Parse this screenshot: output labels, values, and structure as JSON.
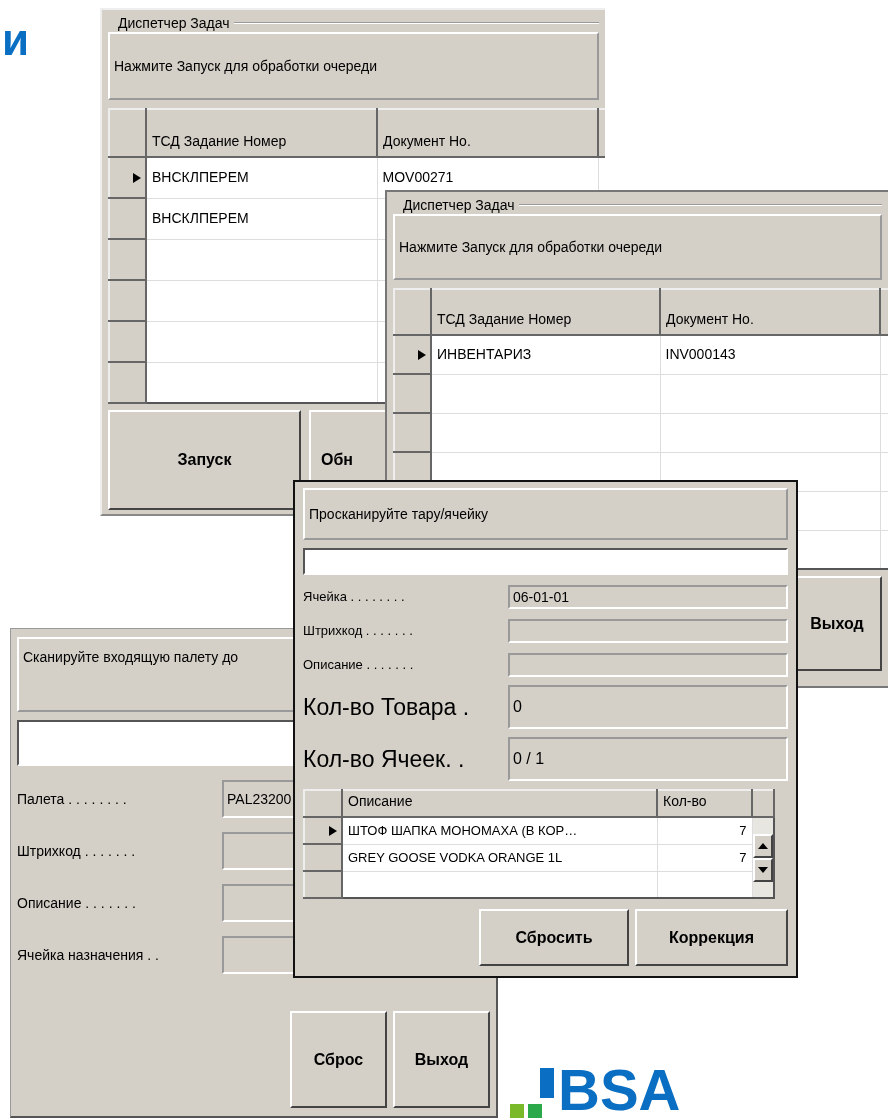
{
  "heading": "и",
  "windows": [
    {
      "kind": "task_dispatcher",
      "group_title": "Диспетчер Задач",
      "message": "Нажмите Запуск для обработки очереди",
      "grid": {
        "columns": [
          "ТСД Задание Номер",
          "Документ Но."
        ],
        "rows": [
          {
            "cells": [
              "ВНСКЛПЕРЕМ",
              "MOV00271"
            ],
            "selected": true
          },
          {
            "cells": [
              "ВНСКЛПЕРЕМ"
            ],
            "selected": false
          }
        ]
      },
      "buttons": [
        "Запуск",
        "Обн"
      ]
    },
    {
      "kind": "task_dispatcher",
      "group_title": "Диспетчер Задач",
      "message": "Нажмите Запуск для обработки очереди",
      "grid": {
        "columns": [
          "ТСД Задание Номер",
          "Документ Но."
        ],
        "rows": [
          {
            "cells": [
              "ИНВЕНТАРИЗ",
              "INV000143"
            ],
            "selected": true
          }
        ]
      },
      "buttons": [
        "Выход"
      ]
    },
    {
      "kind": "form",
      "message": "Сканируйте входящую палету до",
      "fields": [
        {
          "kind": "normal",
          "label": "Палета . . . . . . . .",
          "value": "PAL23200"
        },
        {
          "kind": "normal",
          "label": "Штрихкод . . . . . . ."
        },
        {
          "kind": "normal",
          "label": "Описание . . . . . . ."
        },
        {
          "kind": "normal",
          "label": "Ячейка назначения . ."
        }
      ],
      "buttons": [
        "Сброс",
        "Выход"
      ]
    },
    {
      "kind": "form",
      "message": "Просканируйте тару/ячейку",
      "fields": [
        {
          "kind": "normal",
          "label": "Ячейка . . . . . . . .",
          "value": "06-01-01"
        },
        {
          "kind": "normal",
          "label": "Штрихкод . . . . . . ."
        },
        {
          "kind": "normal",
          "label": "Описание . . . . . . ."
        },
        {
          "kind": "large",
          "label": "Кол-во Товара .",
          "value": "0"
        },
        {
          "kind": "large",
          "label": "Кол-во Ячеек.  .",
          "value": "0 / 1"
        }
      ],
      "grid": {
        "columns": [
          "Описание",
          "Кол-во"
        ],
        "rows": [
          {
            "cells": [
              "ШТОФ ШАПКА МОНОМАХА (В КОР…",
              "7"
            ],
            "selected": true
          },
          {
            "cells": [
              "GREY GOOSE VODKA ORANGE 1L",
              "7"
            ],
            "selected": false
          }
        ]
      },
      "buttons": [
        "Сбросить",
        "Коррекция"
      ]
    }
  ],
  "logo": {
    "text": "BSA"
  }
}
